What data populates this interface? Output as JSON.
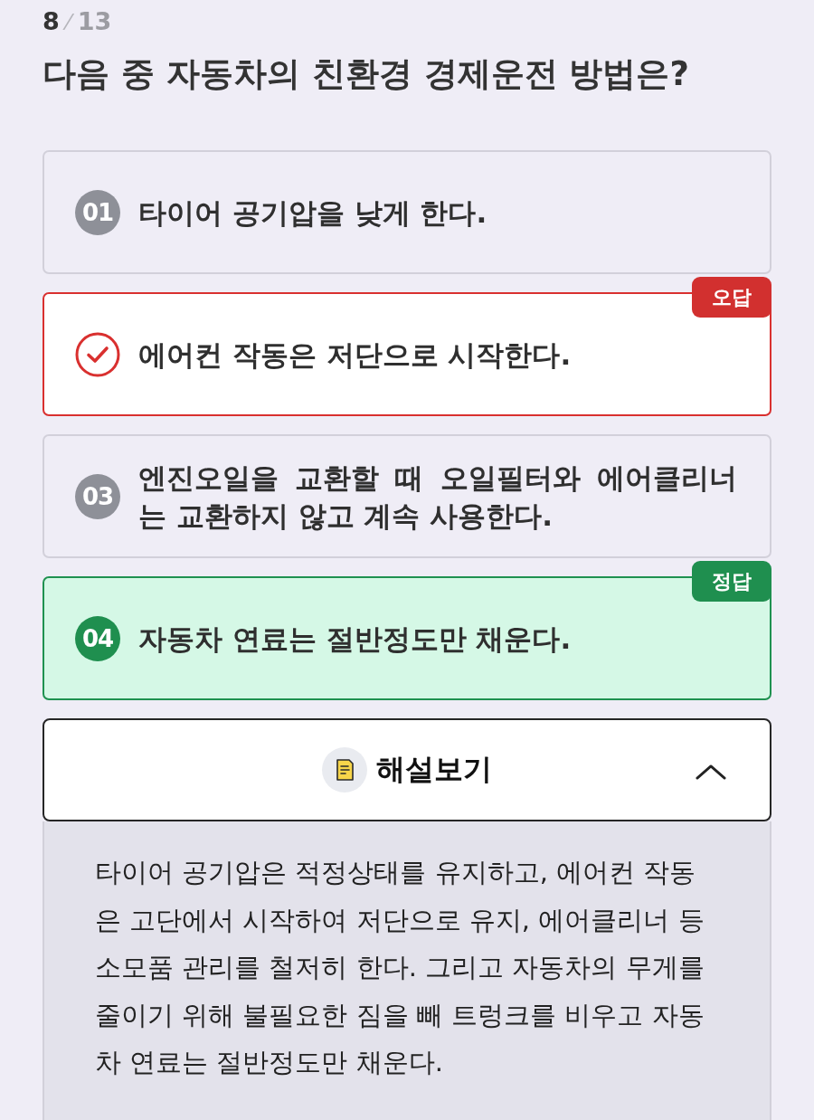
{
  "progress": {
    "current": "8",
    "separator": "⁄",
    "total": "13"
  },
  "question": "다음 중 자동차의 친환경 경제운전 방법은?",
  "options": [
    {
      "number": "01",
      "text": "타이어 공기압을 낮게 한다.",
      "selected": false,
      "correct": false
    },
    {
      "text": "에어컨 작동은 저단으로 시작한다.",
      "selected": true,
      "correct": false,
      "badge": "오답"
    },
    {
      "number": "03",
      "text": "엔진오일을 교환할 때 오일필터와 에어클리너는 교환하지 않고 계속 사용한다.",
      "selected": false,
      "correct": false
    },
    {
      "number": "04",
      "text": "자동차 연료는 절반정도만 채운다.",
      "selected": false,
      "correct": true,
      "badge": "정답"
    }
  ],
  "explanation": {
    "label": "해설보기",
    "expanded": true,
    "text": "타이어 공기압은 적정상태를 유지하고, 에어컨 작동은 고단에서 시작하여 저단으로 유지, 에어클리너 등 소모품 관리를 철저히 한다. 그리고 자동차의 무게를 줄이기 위해 불필요한 짐을 빼 트렁크를 비우고 자동차 연료는 절반정도만 채운다."
  }
}
